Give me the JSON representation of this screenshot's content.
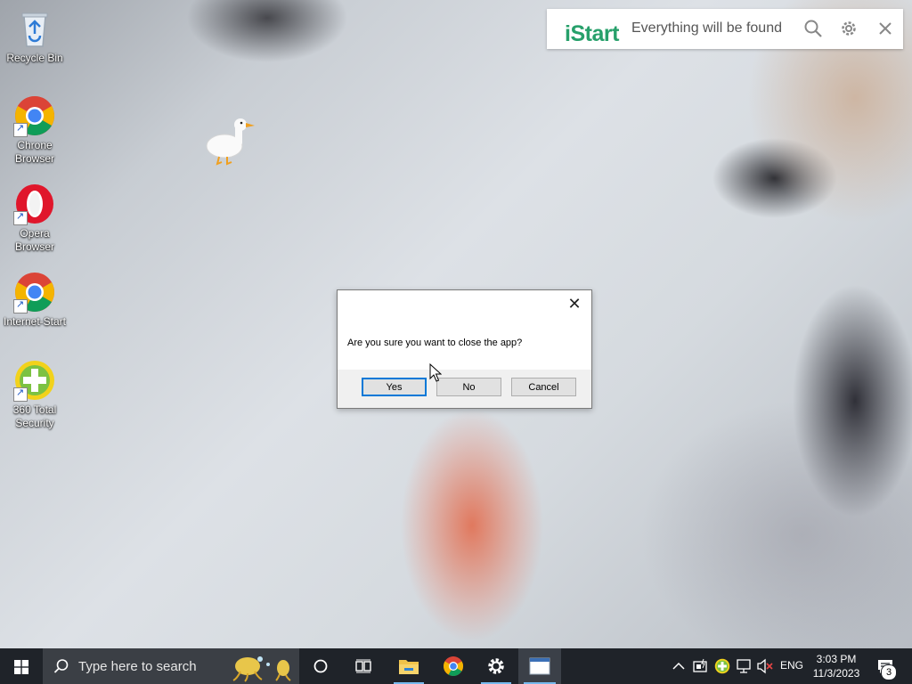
{
  "desktop": {
    "icons": [
      {
        "label": "Recycle Bin"
      },
      {
        "label": "Chrone Browser"
      },
      {
        "label": "Opera Browser"
      },
      {
        "label": "Internet-Start"
      },
      {
        "label": "360 Total Security"
      }
    ]
  },
  "istart": {
    "logo": "iStart",
    "tagline": "Everything will be found",
    "brand_color": "#27a06b"
  },
  "dialog": {
    "message": "Are you sure you want to close the app?",
    "buttons": {
      "yes": "Yes",
      "no": "No",
      "cancel": "Cancel"
    }
  },
  "taskbar": {
    "search_placeholder": "Type here to search",
    "language": "ENG",
    "time": "3:03 PM",
    "date": "11/3/2023",
    "notification_count": "3",
    "active_accent": "#76b9ed"
  }
}
